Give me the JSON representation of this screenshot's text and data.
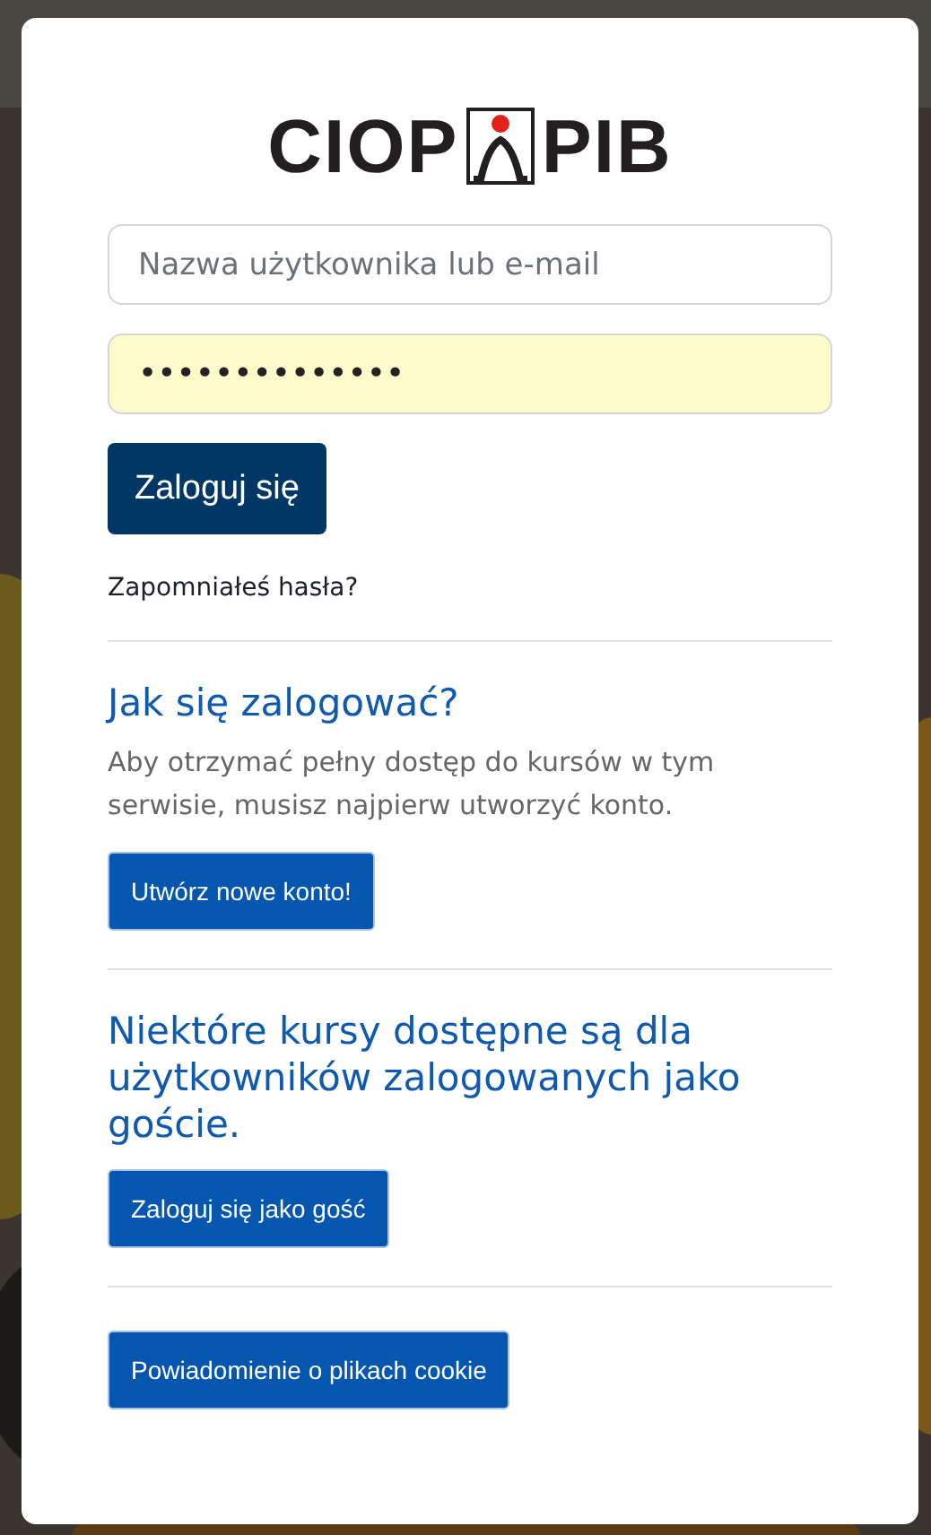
{
  "logo": {
    "left": "CIOP",
    "right": "PIB"
  },
  "username": {
    "placeholder": "Nazwa użytkownika lub e-mail"
  },
  "password": {
    "value": "••••••••••••••",
    "autofilled": true
  },
  "login_button": "Zaloguj się",
  "forgot_link": "Zapomniałeś hasła?",
  "signup": {
    "heading": "Jak się zalogować?",
    "text": "Aby otrzymać pełny dostęp do kursów w tym serwisie, musisz najpierw utworzyć konto.",
    "button": "Utwórz nowe konto!"
  },
  "guest": {
    "heading": "Niektóre kursy dostępne są dla użytkowników zalogowanych jako goście.",
    "button": "Zaloguj się jako gość"
  },
  "cookie_button": "Powiadomienie o plikach cookie"
}
